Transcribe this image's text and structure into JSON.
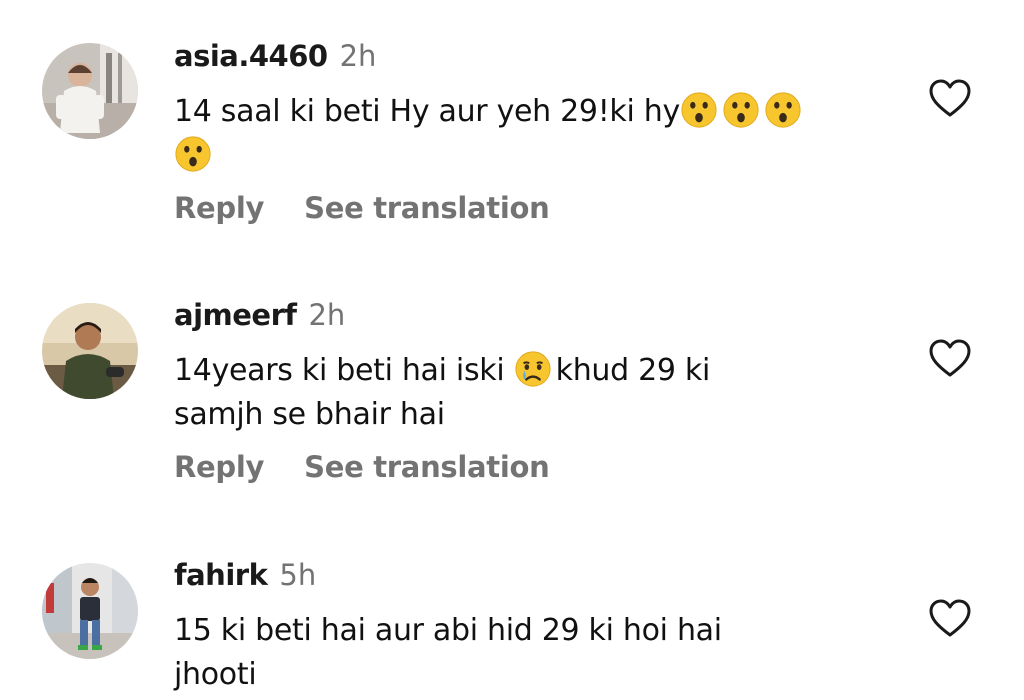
{
  "comments": [
    {
      "username": "asia.4460",
      "time": "2h",
      "text_before_emoji": "14 saal ki beti Hy aur yeh 29!ki hy",
      "emojis": [
        "astonished-face",
        "astonished-face",
        "astonished-face",
        "astonished-face"
      ],
      "text_after_emoji": "",
      "line2": "",
      "reply_label": "Reply",
      "translate_label": "See translation"
    },
    {
      "username": "ajmeerf",
      "time": "2h",
      "text_before_emoji": "14years ki beti hai iski ",
      "emojis": [
        "crying-face"
      ],
      "text_after_emoji": "khud 29 ki",
      "line2": "samjh se bhair hai",
      "reply_label": "Reply",
      "translate_label": "See translation"
    },
    {
      "username": "fahirk",
      "time": "5h",
      "text_before_emoji": "15 ki beti hai aur abi hid 29 ki hoi hai",
      "emojis": [],
      "text_after_emoji": "",
      "line2": "jhooti",
      "reply_label": "",
      "translate_label": ""
    }
  ],
  "colors": {
    "username": "#1a1a1a",
    "secondary": "#737373",
    "text": "#111111",
    "emoji": "#f7c62f"
  },
  "icons": {
    "like": "heart-outline-icon"
  }
}
